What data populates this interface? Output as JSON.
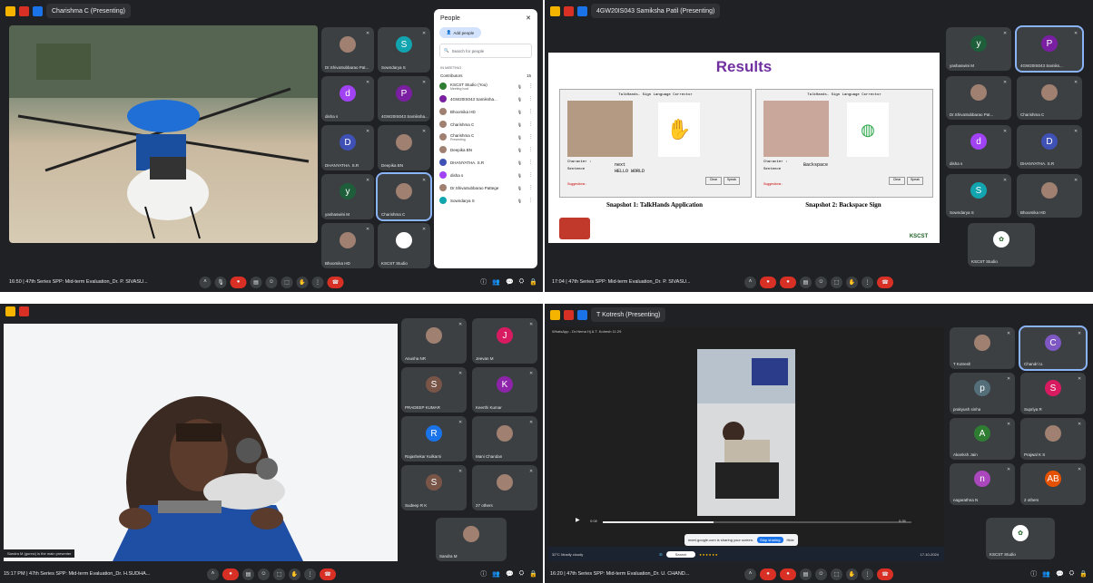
{
  "q1": {
    "presenter": "Charishma C (Presenting)",
    "time": "16:50",
    "meeting": "47th Series SPP: Mid-term Evaluation_Dr. P. SIVASU...",
    "tiles": [
      {
        "name": "Dr.ShivaSubbarao Pat...",
        "initial": "",
        "color": "#a08070"
      },
      {
        "name": "Sowndarya S",
        "initial": "S",
        "color": "#12a4af"
      },
      {
        "name": "disha s",
        "initial": "d",
        "color": "#a142f4"
      },
      {
        "name": "4GW20IS043 Samiksha...",
        "initial": "P",
        "color": "#7b1fa2"
      },
      {
        "name": "DHANYATHA. S.R",
        "initial": "D",
        "color": "#3f51b5"
      },
      {
        "name": "Deepika BN",
        "initial": "",
        "color": "#a08070"
      },
      {
        "name": "yashaswini M",
        "initial": "y",
        "color": "#1e5e3a"
      },
      {
        "name": "Charishma C",
        "initial": "",
        "color": "#a08070"
      },
      {
        "name": "Bhoomika HD",
        "initial": "",
        "color": "#a08070"
      },
      {
        "name": "KSCST Studio",
        "initial": "",
        "color": "#ffffff"
      }
    ],
    "people": {
      "title": "People",
      "add": "Add people",
      "search_placeholder": "Search for people",
      "section": "IN MEETING",
      "contributors": "Contributors",
      "count": "15",
      "list": [
        {
          "name": "KSCST Studio (You)",
          "sub": "Meeting host",
          "color": "#2e7d32"
        },
        {
          "name": "4GW20IS043 Samiksha...",
          "sub": "",
          "color": "#7b1fa2"
        },
        {
          "name": "Bhoomika HD",
          "sub": "",
          "color": "#a08070"
        },
        {
          "name": "Charishma C",
          "sub": "",
          "color": "#a08070"
        },
        {
          "name": "Charishma C",
          "sub": "Presenting",
          "color": "#a08070"
        },
        {
          "name": "Deepika BN",
          "sub": "",
          "color": "#a08070"
        },
        {
          "name": "DHANYATHA. S.R",
          "sub": "",
          "color": "#3f51b5"
        },
        {
          "name": "disha s",
          "sub": "",
          "color": "#a142f4"
        },
        {
          "name": "Dr.ShivaSubbarao Pattege",
          "sub": "",
          "color": "#a08070"
        },
        {
          "name": "Sowndarya S",
          "sub": "",
          "color": "#12a4af"
        }
      ]
    }
  },
  "q2": {
    "presenter": "4GW20IS043 Samiksha Patil (Presenting)",
    "time": "17:04",
    "meeting": "47th Series SPP: Mid-term Evaluation_Dr. P. SIVASU...",
    "slide_title": "Results",
    "app_title": "TalkHands- Sign Language Corrector",
    "snap1": {
      "char_label": "Character :",
      "char_val": "next",
      "sent_label": "Sentence",
      "sent_val": "HELLO WORLD",
      "caption": "Snapshot 1: TalkHands Application"
    },
    "snap2": {
      "char_label": "Character :",
      "char_val": "Backspace",
      "sent_label": "Sentence",
      "sent_val": "",
      "caption": "Snapshot 2: Backspace Sign"
    },
    "suggestions": "Suggestions :",
    "btn_clear": "Clear",
    "btn_speak": "Speak",
    "logo": "KSCST",
    "tiles": [
      {
        "name": "yashaswini M",
        "initial": "y",
        "color": "#1e5e3a"
      },
      {
        "name": "4GW20IS043 Samiks...",
        "initial": "P",
        "color": "#7b1fa2"
      },
      {
        "name": "Dr.ShivaSubbarao Pat...",
        "initial": "",
        "color": "#a08070"
      },
      {
        "name": "Charishma C",
        "initial": "",
        "color": "#a08070"
      },
      {
        "name": "disha s",
        "initial": "d",
        "color": "#a142f4"
      },
      {
        "name": "DHANYATHA. S.R",
        "initial": "D",
        "color": "#3f51b5"
      },
      {
        "name": "Sowndarya S",
        "initial": "S",
        "color": "#12a4af"
      },
      {
        "name": "Bhoomika HD",
        "initial": "",
        "color": "#a08070"
      }
    ],
    "studio": "KSCST Studio"
  },
  "q3": {
    "caption": "Sandra M (gunnc) is the main presenter",
    "time": "15:17 PM",
    "meeting": "47th Series SPP: Mid-term Evaluation_Dr. H.SUDHA...",
    "tiles": [
      {
        "name": "Anusha NR",
        "initial": "",
        "color": "#a08070"
      },
      {
        "name": "Jeevan M",
        "initial": "J",
        "color": "#d81b60"
      },
      {
        "name": "PRADEEP KUMAR",
        "initial": "S",
        "color": "#795548"
      },
      {
        "name": "Keerthi Kumar",
        "initial": "K",
        "color": "#8e24aa"
      },
      {
        "name": "Rajashekar Kulkarni",
        "initial": "R",
        "color": "#1a73e8"
      },
      {
        "name": "Mani Chandan",
        "initial": "",
        "color": "#a08070"
      },
      {
        "name": "Sudeep R K",
        "initial": "S",
        "color": "#795548"
      },
      {
        "name": "27 others",
        "initial": "",
        "color": "#a08070"
      }
    ],
    "last": "Sandra M"
  },
  "q4": {
    "presenter": "T Kotresh (Presenting)",
    "player_title": "WhatsApp - Dr.Hema Hj & T. Kotresh 11:29",
    "time": "16:20",
    "meeting": "47th Series SPP: Mid-term Evaluation_Dr. U. CHAND...",
    "share_msg": "meet.google.com is sharing your screen.",
    "stop_share": "Stop sharing",
    "hide": "Hide",
    "weather_temp": "32°C",
    "weather_txt": "Mostly cloudy",
    "search": "Search",
    "clock": "17-10-2024",
    "vid_start": "0:08",
    "vid_end": "0:35",
    "tiles": [
      {
        "name": "T Kotresh",
        "initial": "",
        "color": "#a08070"
      },
      {
        "name": "Chandri U.",
        "initial": "C",
        "color": "#7e57c2"
      },
      {
        "name": "prakyush sinha",
        "initial": "p",
        "color": "#546e7a"
      },
      {
        "name": "Supriya R",
        "initial": "S",
        "color": "#d81b60"
      },
      {
        "name": "Akanksh Jain",
        "initial": "A",
        "color": "#2e7d32"
      },
      {
        "name": "Prajwal K S",
        "initial": "",
        "color": "#a08070"
      },
      {
        "name": "nagarathna N",
        "initial": "n",
        "color": "#ab47bc"
      },
      {
        "name": "2 others",
        "initial": "AB",
        "color": "#e65100"
      }
    ],
    "studio": "KSCST Studio"
  }
}
